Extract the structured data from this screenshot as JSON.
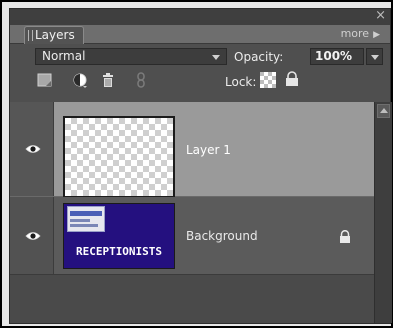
{
  "window": {
    "close_glyph": "×"
  },
  "tab": {
    "label": "Layers",
    "more_label": "more",
    "more_arrow": "▶"
  },
  "controls": {
    "blend_mode": "Normal",
    "opacity_label": "Opacity:",
    "opacity_value": "100%",
    "lock_label": "Lock:"
  },
  "tools": [
    {
      "name": "new-layer-icon"
    },
    {
      "name": "adjustment-layer-icon"
    },
    {
      "name": "trash-icon"
    },
    {
      "name": "link-icon"
    },
    {
      "name": "lock-transparency-icon"
    },
    {
      "name": "lock-all-icon"
    }
  ],
  "layers": [
    {
      "name": "Layer 1",
      "visible": true,
      "selected": true,
      "thumbnail": "transparent"
    },
    {
      "name": "Background",
      "visible": true,
      "selected": false,
      "locked": true,
      "thumbnail": "receptionists-image",
      "thumbnail_text": "RECEPTIONISTS"
    }
  ],
  "colors": {
    "panel_bg": "#4a4a4a",
    "selected_row_bg": "#9a9a9a",
    "thumbnail_blue": "#24107f"
  }
}
